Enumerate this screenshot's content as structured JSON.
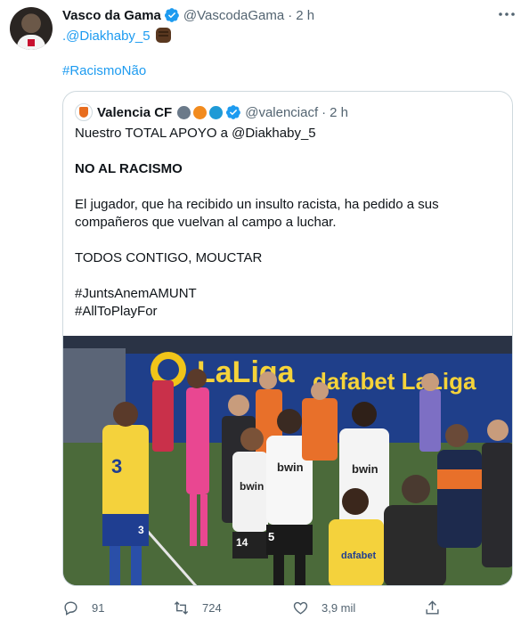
{
  "tweet": {
    "author_name": "Vasco da Gama",
    "handle": "@VascodaGama",
    "time": "2 h",
    "mention": ".@Diakhaby_5",
    "hashtag": "#RacismoNão"
  },
  "quoted": {
    "author_name": "Valencia CF",
    "handle": "@valenciacf",
    "time": "2 h",
    "lines": {
      "l1": "Nuestro TOTAL APOYO a @Diakhaby_5",
      "l2": "NO AL RACISMO",
      "l3": "El jugador, que ha recibido un insulto racista, ha pedido a sus",
      "l4": "compañeros que vuelvan al campo a luchar.",
      "l5": "TODOS CONTIGO, MOUCTAR",
      "l6": "#JuntsAnemAMUNT",
      "l7": "#AllToPlayFor"
    },
    "photo_text": {
      "board_left": "LaLiga",
      "board_right": "dafabet  LaLiga",
      "sponsor_a": "bwin",
      "sponsor_b": "bwin",
      "sponsor_c": "bwin",
      "sponsor_d": "dafabet",
      "number_a": "3",
      "number_b": "3",
      "number_c": "14",
      "number_d": "5"
    }
  },
  "actions": {
    "replies": "91",
    "retweets": "724",
    "likes": "3,9 mil"
  },
  "colors": {
    "link": "#1d9bf0",
    "verified": "#1d9bf0",
    "muted": "#536471",
    "border": "#cfd9de"
  },
  "icons": {
    "verified": "verified-badge-icon",
    "more": "more-dots-icon",
    "reply": "reply-icon",
    "retweet": "retweet-icon",
    "like": "heart-icon",
    "share": "share-icon"
  }
}
